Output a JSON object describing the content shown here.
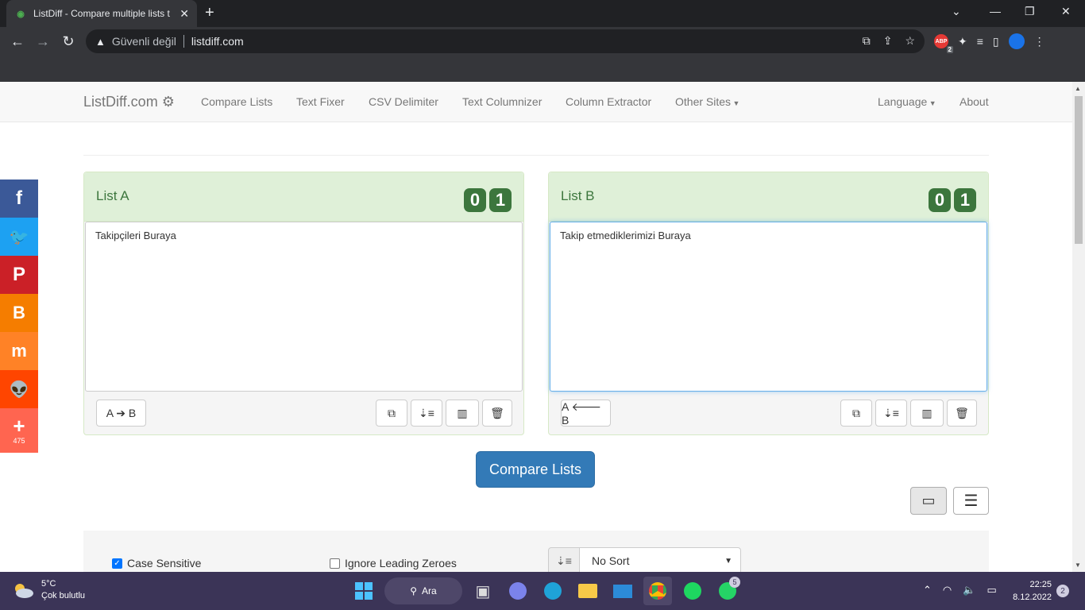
{
  "browser": {
    "tab_title": "ListDiff - Compare multiple lists t",
    "tab_close": "✕",
    "new_tab": "+",
    "security_label": "Güvenli değil",
    "url": "listdiff.com"
  },
  "navbar": {
    "brand": "ListDiff.com",
    "links": [
      "Compare Lists",
      "Text Fixer",
      "CSV Delimiter",
      "Text Columnizer",
      "Column Extractor",
      "Other Sites"
    ],
    "language": "Language",
    "about": "About"
  },
  "list_a": {
    "title": "List A",
    "count_1": "0",
    "count_2": "1",
    "content": "Takipçileri Buraya",
    "move_button": "A ➔ B"
  },
  "list_b": {
    "title": "List B",
    "count_1": "0",
    "count_2": "1",
    "content": "Takip etmediklerimizi Buraya",
    "move_button": "A 🡐 B"
  },
  "compare_button": "Compare Lists",
  "options": {
    "case_sensitive": {
      "label": "Case Sensitive",
      "checked": true
    },
    "ignore_leading_zeroes": {
      "label": "Ignore Leading Zeroes",
      "checked": false
    },
    "sort_value": "No Sort"
  },
  "share": {
    "count": "475",
    "colors": {
      "facebook": "#3b5998",
      "twitter": "#1da1f2",
      "pinterest": "#cb2027",
      "blogger": "#f57d00",
      "mix": "#ff8226",
      "reddit": "#ff4500",
      "more": "#ff6550"
    }
  },
  "taskbar": {
    "temp": "5°C",
    "weather": "Çok bulutlu",
    "search": "Ara",
    "whatsapp_badge": "5",
    "time": "22:25",
    "date": "8.12.2022",
    "notifications": "2"
  }
}
